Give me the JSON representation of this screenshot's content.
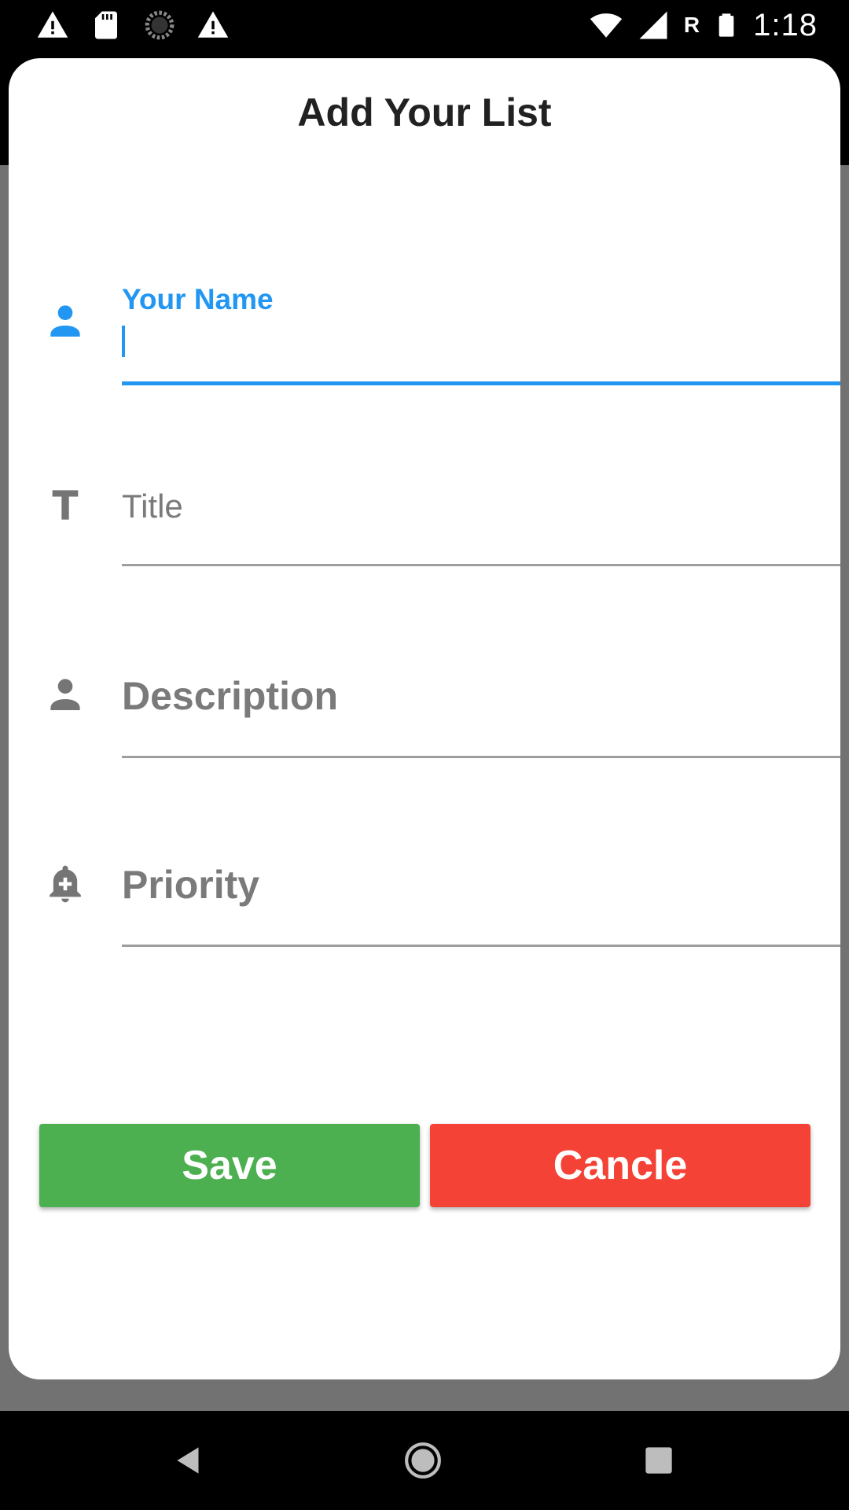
{
  "status_bar": {
    "time": "1:18",
    "roaming": "R",
    "icons": [
      "warning-icon",
      "sd-card-icon",
      "loading-icon",
      "warning-icon",
      "wifi-icon",
      "signal-icon",
      "battery-icon"
    ]
  },
  "dialog": {
    "title": "Add Your List",
    "fields": [
      {
        "name": "your-name",
        "label": "Your Name",
        "icon": "person-icon",
        "active": true
      },
      {
        "name": "title",
        "placeholder": "Title",
        "icon": "text-icon"
      },
      {
        "name": "description",
        "placeholder": "Description",
        "icon": "person-icon"
      },
      {
        "name": "priority",
        "placeholder": "Priority",
        "icon": "add-alert-icon"
      }
    ],
    "buttons": {
      "save": "Save",
      "cancel": "Cancle"
    }
  },
  "colors": {
    "accent": "#2196f3",
    "save": "#4caf50",
    "cancel": "#f44336",
    "icon_gray": "#757575"
  },
  "nav_bar": {
    "icons": [
      "back-icon",
      "home-icon",
      "recents-icon"
    ]
  }
}
